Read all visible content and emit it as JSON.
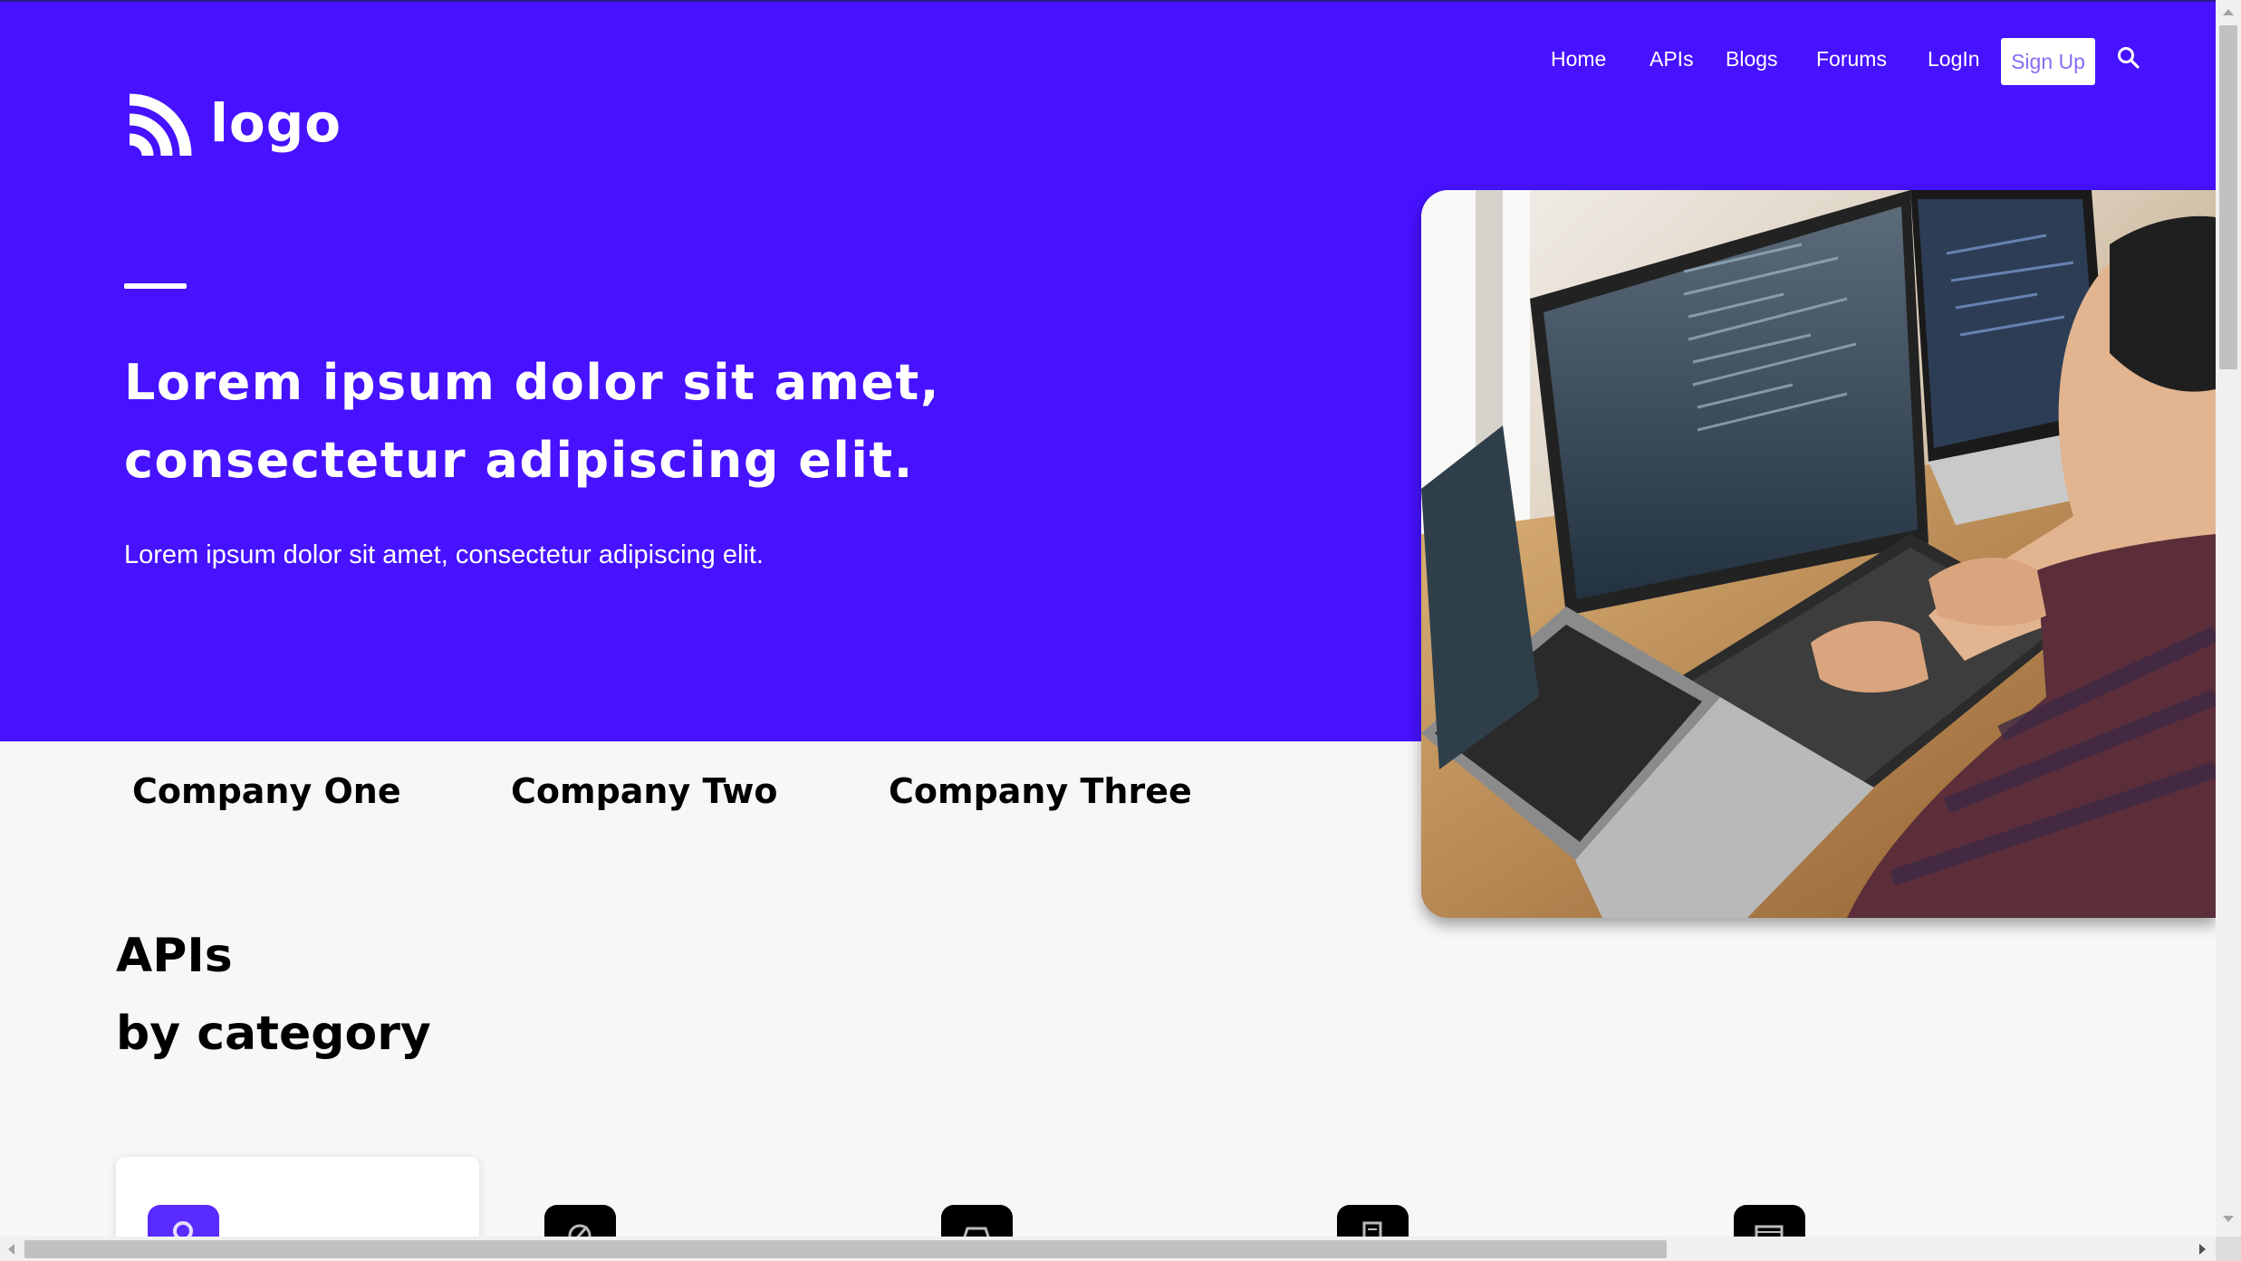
{
  "header": {
    "logo_text": "logo",
    "nav": [
      "Home",
      "APIs",
      "Blogs",
      "Forums",
      "LogIn"
    ],
    "signup_label": "Sign Up",
    "search_icon": "search-icon"
  },
  "hero": {
    "title_line1": "Lorem ipsum dolor sit amet,",
    "title_line2": "consectetur adipiscing elit.",
    "subtitle": "Lorem ipsum dolor sit amet, consectetur adipiscing elit.",
    "image": "developer-at-computer-photo"
  },
  "companies": [
    "Company One",
    "Company Two",
    "Company Three"
  ],
  "apis": {
    "title_line1": "APIs",
    "title_line2": "by category",
    "category_icons": [
      "location-icon",
      "compass-icon",
      "car-icon",
      "document-icon",
      "monitor-icon"
    ]
  },
  "colors": {
    "brand": "#4612ff",
    "page_bg": "#f7f7f9",
    "active_icon": "#5a2bff"
  }
}
